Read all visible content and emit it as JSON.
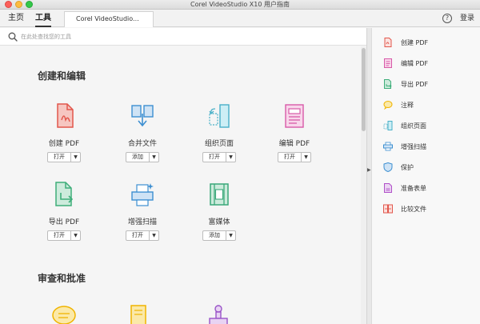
{
  "window": {
    "title": "Corel VideoStudio X10 用户指南"
  },
  "topbar": {
    "home_label": "主页",
    "tools_label": "工具",
    "doc_tab_label": "Corel VideoStudio...",
    "help_icon": "question-circle-icon",
    "help_glyph": "?",
    "login_label": "登录"
  },
  "search": {
    "placeholder": "在此处查找您的工具",
    "icon": "search-icon"
  },
  "sections": [
    {
      "title": "创建和编辑"
    },
    {
      "title": "审查和批准"
    }
  ],
  "tools": [
    {
      "label": "创建 PDF",
      "button": "打开",
      "icon": "create-pdf-icon",
      "color": "#e2574c"
    },
    {
      "label": "合并文件",
      "button": "添加",
      "icon": "combine-files-icon",
      "color": "#3d8fd1"
    },
    {
      "label": "组织页面",
      "button": "打开",
      "icon": "organize-pages-icon",
      "color": "#49b0c8"
    },
    {
      "label": "编辑 PDF",
      "button": "打开",
      "icon": "edit-pdf-icon",
      "color": "#d85aa8"
    },
    {
      "label": "导出 PDF",
      "button": "打开",
      "icon": "export-pdf-icon",
      "color": "#3fae7a"
    },
    {
      "label": "增强扫描",
      "button": "打开",
      "icon": "enhance-scan-icon",
      "color": "#3d8fd1"
    },
    {
      "label": "富媒体",
      "button": "添加",
      "icon": "rich-media-icon",
      "color": "#3aa87a"
    }
  ],
  "sidebar": {
    "items": [
      {
        "label": "创建 PDF",
        "icon": "create-pdf-icon",
        "color": "#e2574c"
      },
      {
        "label": "编辑 PDF",
        "icon": "edit-pdf-icon",
        "color": "#d85aa8"
      },
      {
        "label": "导出 PDF",
        "icon": "export-pdf-icon",
        "color": "#3fae7a"
      },
      {
        "label": "注释",
        "icon": "comment-icon",
        "color": "#f0b400"
      },
      {
        "label": "组织页面",
        "icon": "organize-pages-icon",
        "color": "#49b0c8"
      },
      {
        "label": "增强扫描",
        "icon": "enhance-scan-icon",
        "color": "#3d8fd1"
      },
      {
        "label": "保护",
        "icon": "protect-shield-icon",
        "color": "#3d8fd1"
      },
      {
        "label": "准备表单",
        "icon": "prepare-form-icon",
        "color": "#b050c8"
      },
      {
        "label": "比较文件",
        "icon": "compare-files-icon",
        "color": "#e2574c"
      }
    ]
  }
}
